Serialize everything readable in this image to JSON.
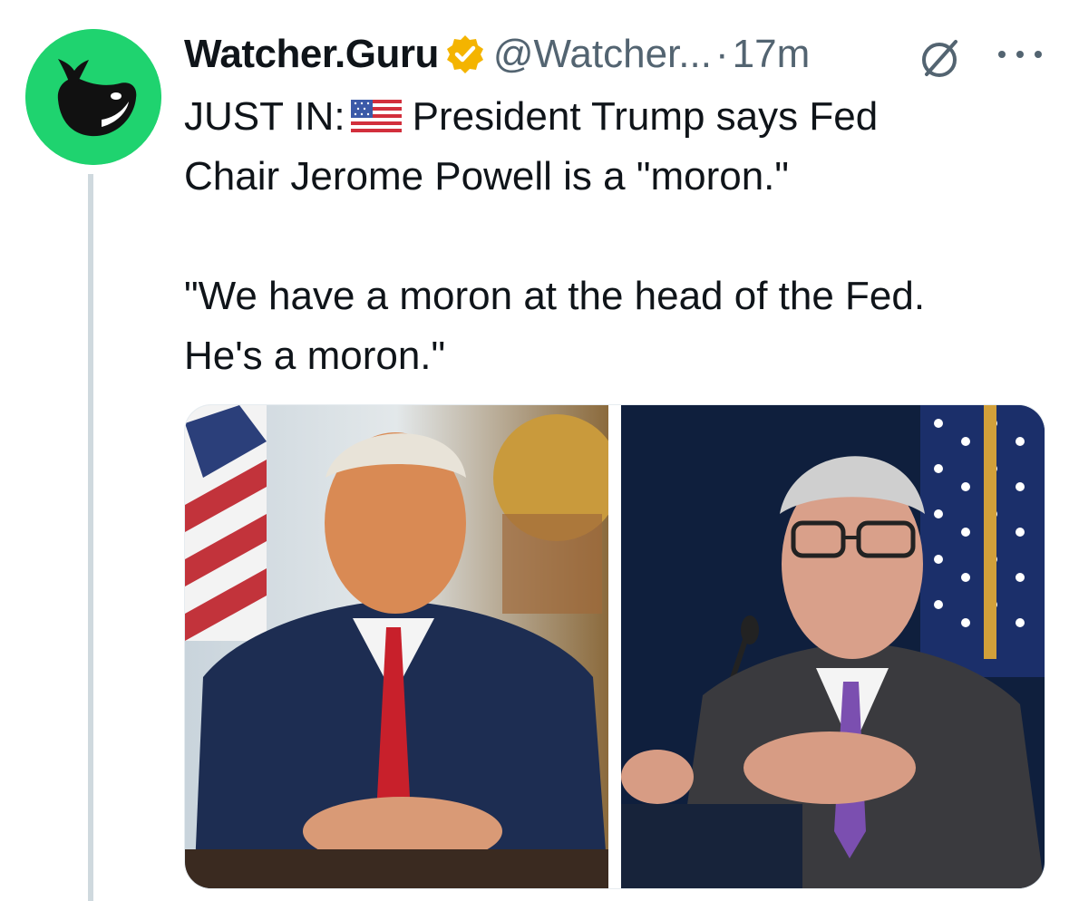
{
  "author": {
    "display_name": "Watcher.Guru",
    "handle": "@Watcher...",
    "separator": "·",
    "timestamp": "17m",
    "verified": true,
    "avatar_icon": "whale-logo-icon",
    "avatar_color": "#1fd36f",
    "badge_color": "#f4b400"
  },
  "tweet": {
    "line1_prefix": "JUST IN:",
    "flag_icon": "us-flag-icon",
    "line1_suffix": "President Trump says Fed",
    "line2": "Chair Jerome Powell is a \"moron.\"",
    "quote_line1": "\"We have a moron at the head of the Fed.",
    "quote_line2": "He's a moron.\""
  },
  "icons": {
    "grok": "grok-icon",
    "more": "more-options-icon"
  },
  "media": {
    "images": [
      {
        "name": "trump-photo",
        "icon": "portrait-photo"
      },
      {
        "name": "powell-photo",
        "icon": "portrait-photo"
      }
    ]
  }
}
